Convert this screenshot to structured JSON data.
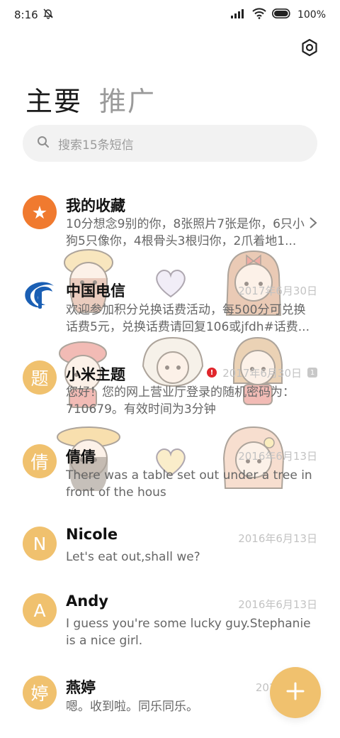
{
  "status_bar": {
    "time": "8:16",
    "battery": "100"
  },
  "tabs": [
    {
      "label": "主要"
    },
    {
      "label": "推广"
    }
  ],
  "search": {
    "placeholder": "搜索15条短信"
  },
  "conversations": [
    {
      "name": "我的收藏",
      "avatar_text": "★",
      "date": "",
      "preview": "10分想念9别的你，8张照片7张是你，6只小狗5只像你，4根骨头3根归你，2爪着地1..."
    },
    {
      "name": "中国电信",
      "avatar_text": "",
      "date": "2017年6月30日",
      "preview": "欢迎参加积分兑换话费活动，每500分可兑换话费5元，兑换话费请回复106或jfdh#话费..."
    },
    {
      "name": "小米主题",
      "avatar_text": "题",
      "date": "2017年6月30日",
      "preview": "您好！您的网上营业厅登录的随机密码为：710679。有效时间为3分钟"
    },
    {
      "name": "倩倩",
      "avatar_text": "倩",
      "date": "2016年6月13日",
      "preview": "There was a table set out under a tree in front of the hous"
    },
    {
      "name": "Nicole",
      "avatar_text": "N",
      "date": "2016年6月13日",
      "preview": "Let's eat out,shall we?"
    },
    {
      "name": "Andy",
      "avatar_text": "A",
      "date": "2016年6月13日",
      "preview": "I guess you're some lucky guy.Stephanie is a nice girl."
    },
    {
      "name": "燕婷",
      "avatar_text": "婷",
      "date": "2013年",
      "preview": "嗯。收到啦。同乐同乐。"
    }
  ],
  "badges": {
    "error": "!",
    "sim": "1"
  },
  "colors": {
    "avatar": "#f0c16e",
    "favorites_avatar": "#f07a2f",
    "fab": "#f0c16e",
    "error": "#e0262c"
  },
  "icons": {
    "settings": "settings-icon",
    "search": "search-icon",
    "compose": "plus-icon",
    "chevron": "chevron-right-icon"
  }
}
